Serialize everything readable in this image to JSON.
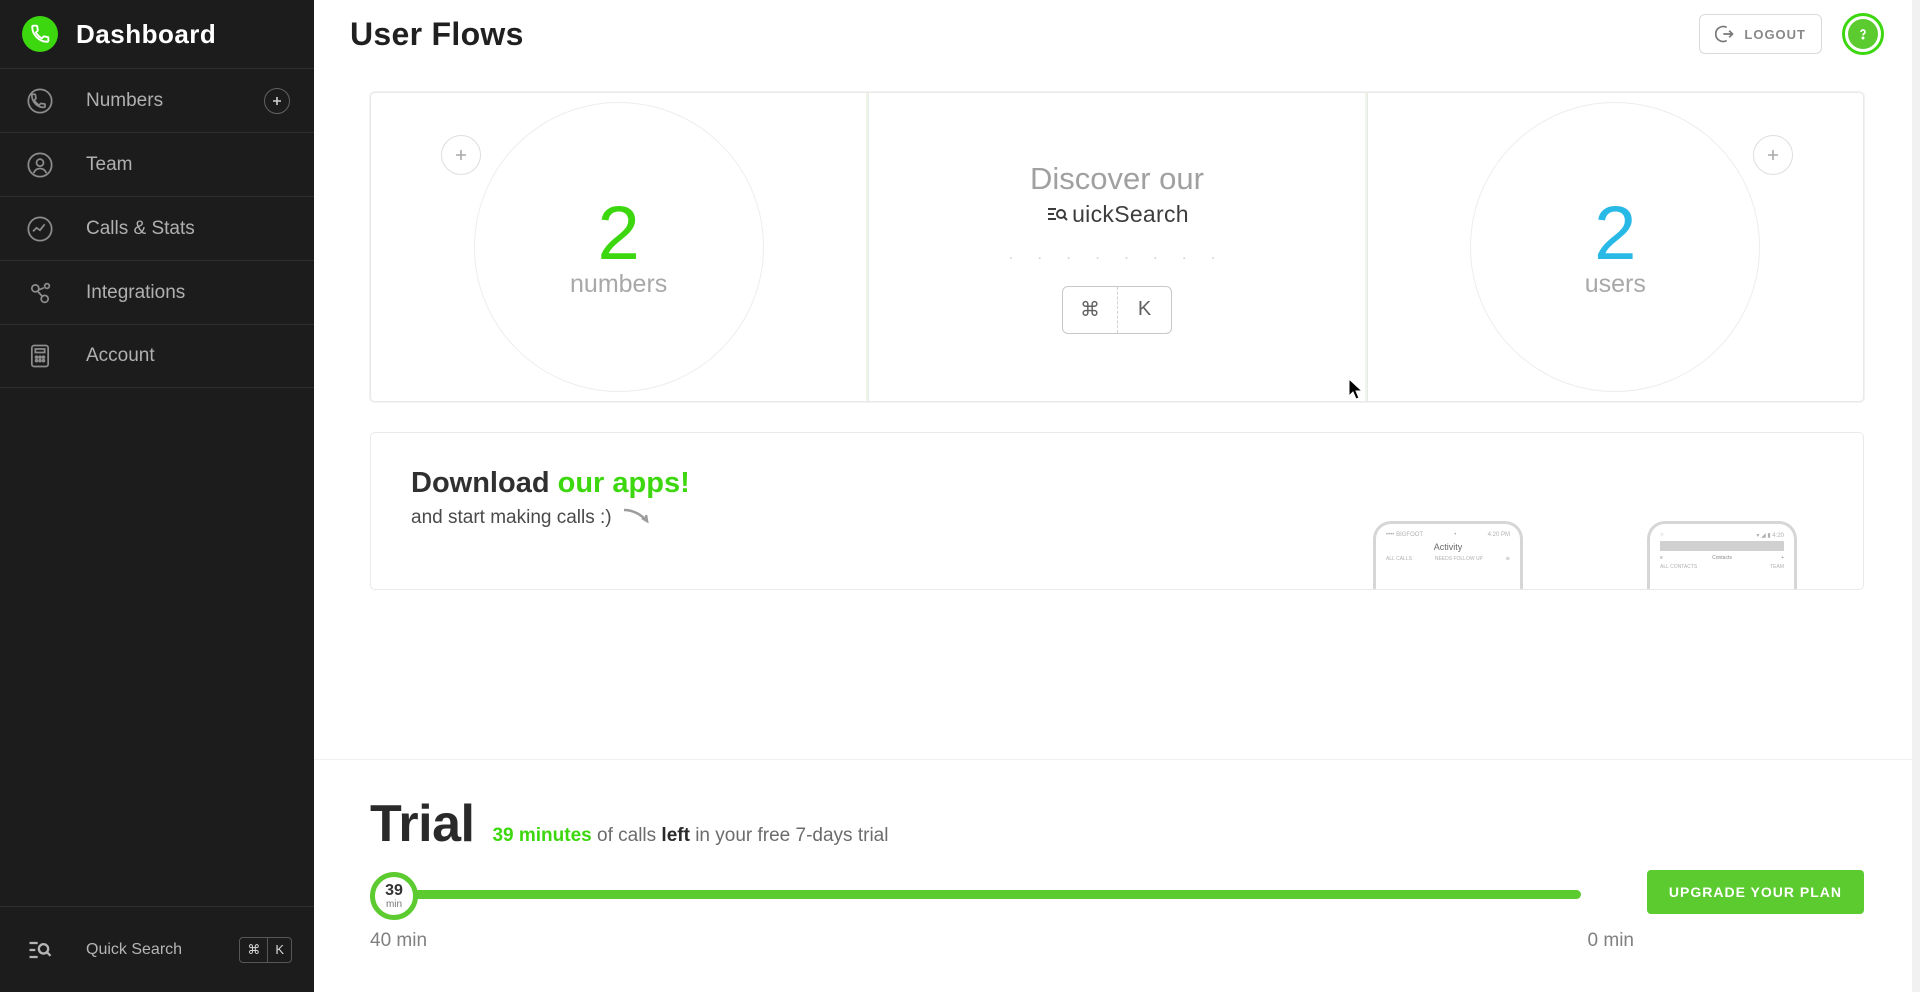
{
  "sidebar": {
    "brand": "Dashboard",
    "items": [
      {
        "label": "Numbers",
        "hasAdd": true
      },
      {
        "label": "Team"
      },
      {
        "label": "Calls & Stats"
      },
      {
        "label": "Integrations"
      },
      {
        "label": "Account"
      }
    ],
    "footer": {
      "search_label": "Quick Search",
      "key1": "⌘",
      "key2": "K"
    }
  },
  "header": {
    "title": "User Flows",
    "logout": "LOGOUT"
  },
  "cards": {
    "numbers": {
      "value": "2",
      "label": "numbers"
    },
    "quicksearch": {
      "title": "Discover our",
      "sub": "uickSearch",
      "dots": ". . . . . . . .",
      "key1": "⌘",
      "key2": "K"
    },
    "users": {
      "value": "2",
      "label": "users"
    }
  },
  "download": {
    "title_plain": "Download ",
    "title_accent": "our apps!",
    "subtitle": "and start making calls :)",
    "phone1": {
      "label": "Activity",
      "tabL": "ALL CALLS",
      "tabR": "NEEDS FOLLOW UP",
      "tl": "•••• BIGFOOT",
      "tc": "•",
      "tr": "4:20 PM"
    },
    "phone2": {
      "label": "Contacts",
      "add": "+",
      "r1": "ALL CONTACTS",
      "r2": "TEAM"
    }
  },
  "trial": {
    "heading": "Trial",
    "minutes": "39 minutes",
    "text_mid": " of calls ",
    "text_bold": "left",
    "text_end": " in your free 7-days trial",
    "knob_value": "39",
    "knob_unit": "min",
    "upgrade": "UPGRADE YOUR PLAN",
    "scale_left": "40 min",
    "scale_right": "0 min"
  }
}
